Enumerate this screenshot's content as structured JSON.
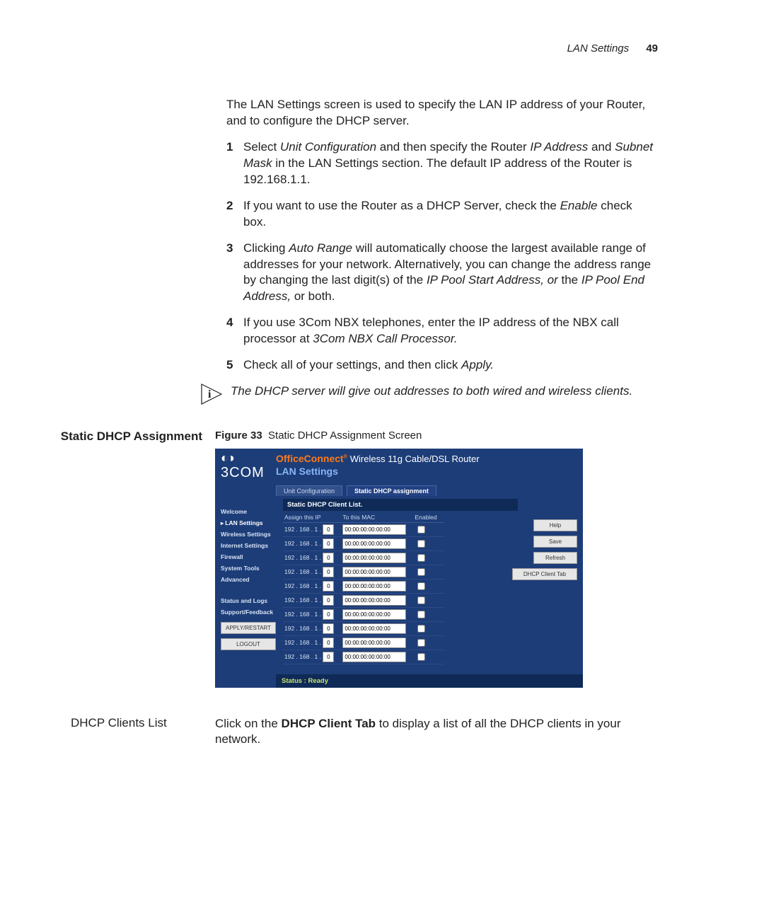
{
  "header": {
    "section": "LAN Settings",
    "page": "49"
  },
  "intro": "The LAN Settings screen is used to specify the LAN IP address of your Router, and to configure the DHCP server.",
  "steps": [
    {
      "n": "1",
      "pre": "Select ",
      "i1": "Unit Configuration",
      "mid": " and then specify the Router ",
      "i2": "IP Address",
      "mid2": " and ",
      "i3": "Subnet Mask",
      "post": " in the LAN Settings section. The default IP address of the Router is 192.168.1.1."
    },
    {
      "n": "2",
      "pre": "If you want to use the Router as a DHCP Server, check the ",
      "i1": "Enable",
      "post": " check box."
    },
    {
      "n": "3",
      "pre": "Clicking ",
      "i1": "Auto Range",
      "mid": " will automatically choose the largest available range of addresses for your network. Alternatively, you can change the address range by changing the last digit(s) of the ",
      "i2": "IP Pool Start Address, or ",
      "mid2": "the ",
      "i3": "IP Pool End Address,",
      "post": " or both."
    },
    {
      "n": "4",
      "pre": "If you use 3Com NBX telephones, enter the IP address of the NBX call processor at ",
      "i1": "3Com NBX Call Processor.",
      "post": ""
    },
    {
      "n": "5",
      "pre": "Check all of your settings, and then click ",
      "i1": "Apply.",
      "post": ""
    }
  ],
  "note": "The DHCP server will give out addresses to both wired and wireless clients.",
  "section_title": "Static DHCP Assignment",
  "figure": {
    "label": "Figure 33",
    "caption": "Static DHCP Assignment Screen"
  },
  "router": {
    "brand": "3COM",
    "product_brand": "OfficeConnect",
    "product_tail": "Wireless 11g Cable/DSL Router",
    "page_title": "LAN Settings",
    "tabs": [
      "Unit Configuration",
      "Static DHCP assignment"
    ],
    "active_tab": 1,
    "sidebar": [
      "Welcome",
      "LAN Settings",
      "Wireless Settings",
      "Internet Settings",
      "Firewall",
      "System Tools",
      "Advanced"
    ],
    "sidebar_active": 1,
    "sidebar_lower": [
      "Status and Logs",
      "Support/Feedback"
    ],
    "side_buttons": [
      "APPLY/RESTART",
      "LOGOUT"
    ],
    "list_title": "Static DHCP Client List.",
    "columns": [
      "Assign this IP",
      "To this MAC",
      "Enabled"
    ],
    "ip_prefix": "192 . 168 . 1 .",
    "rows": [
      {
        "oct": "0",
        "mac": "00:00:00:00:00:00"
      },
      {
        "oct": "0",
        "mac": "00:00:00:00:00:00"
      },
      {
        "oct": "0",
        "mac": "00:00:00:00:00:00"
      },
      {
        "oct": "0",
        "mac": "00:00:00:00:00:00"
      },
      {
        "oct": "0",
        "mac": "00:00:00:00:00:00"
      },
      {
        "oct": "0",
        "mac": "00:00:00:00:00:00"
      },
      {
        "oct": "0",
        "mac": "00:00:00:00:00:00"
      },
      {
        "oct": "0",
        "mac": "00:00:00:00:00:00"
      },
      {
        "oct": "0",
        "mac": "00:00:00:00:00:00"
      },
      {
        "oct": "0",
        "mac": "00:00:00:00:00:00"
      }
    ],
    "right_buttons": [
      "Help",
      "Save",
      "Refresh",
      "DHCP Client Tab"
    ],
    "status": "Status : Ready"
  },
  "bottom": {
    "label": "DHCP Clients List",
    "text_pre": "Click on the ",
    "text_bold": "DHCP Client Tab",
    "text_post": " to display a list of all the DHCP clients in your network."
  }
}
